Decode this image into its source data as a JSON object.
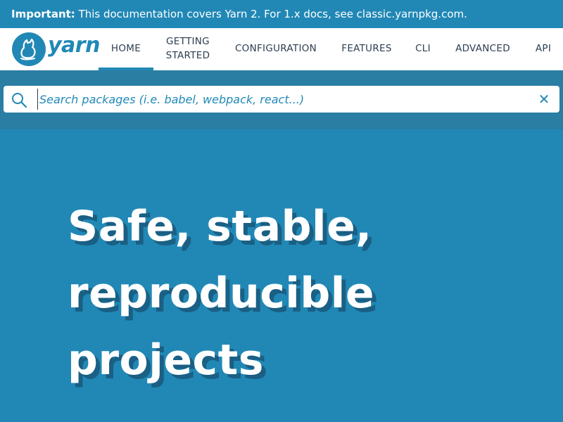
{
  "banner": {
    "strong": "Important:",
    "text": " This documentation covers Yarn 2. For 1.x docs, see classic.yarnpkg.com."
  },
  "logo": {
    "text": "yarn"
  },
  "nav": {
    "items": [
      {
        "label": "HOME"
      },
      {
        "label": "GETTING\nSTARTED"
      },
      {
        "label": "CONFIGURATION"
      },
      {
        "label": "FEATURES"
      },
      {
        "label": "CLI"
      },
      {
        "label": "ADVANCED"
      },
      {
        "label": "API"
      }
    ]
  },
  "search": {
    "placeholder": "Search packages (i.e. babel, webpack, react...)",
    "clear": "✕"
  },
  "hero": {
    "line1": "Safe, stable,",
    "line2": "reproducible",
    "line3": "projects"
  },
  "colors": {
    "brand": "#2188b6",
    "search_band": "#2a7ea3",
    "title_shadow": "#1a5f84"
  }
}
